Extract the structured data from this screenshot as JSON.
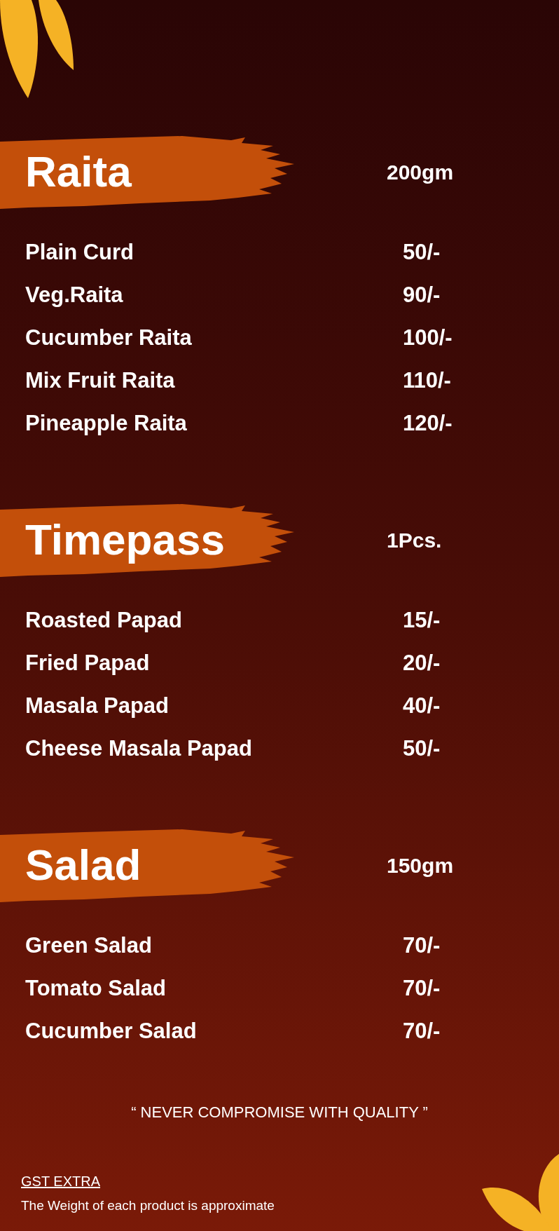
{
  "sections": [
    {
      "title": "Raita",
      "unit": "200gm",
      "items": [
        {
          "name": "Plain Curd",
          "price": "50/-"
        },
        {
          "name": "Veg.Raita",
          "price": "90/-"
        },
        {
          "name": "Cucumber Raita",
          "price": "100/-"
        },
        {
          "name": "Mix Fruit Raita",
          "price": "110/-"
        },
        {
          "name": "Pineapple Raita",
          "price": "120/-"
        }
      ]
    },
    {
      "title": "Timepass",
      "unit": "1Pcs.",
      "items": [
        {
          "name": "Roasted Papad",
          "price": "15/-"
        },
        {
          "name": "Fried Papad",
          "price": "20/-"
        },
        {
          "name": "Masala Papad",
          "price": "40/-"
        },
        {
          "name": "Cheese Masala Papad",
          "price": "50/-"
        }
      ]
    },
    {
      "title": "Salad",
      "unit": "150gm",
      "items": [
        {
          "name": "Green Salad",
          "price": "70/-"
        },
        {
          "name": "Tomato Salad",
          "price": "70/-"
        },
        {
          "name": "Cucumber Salad",
          "price": "70/-"
        }
      ]
    }
  ],
  "quote": "“ NEVER COMPROMISE WITH QUALITY ”",
  "footer": {
    "gst": "GST EXTRA",
    "note": "The Weight of each product is approximate"
  }
}
